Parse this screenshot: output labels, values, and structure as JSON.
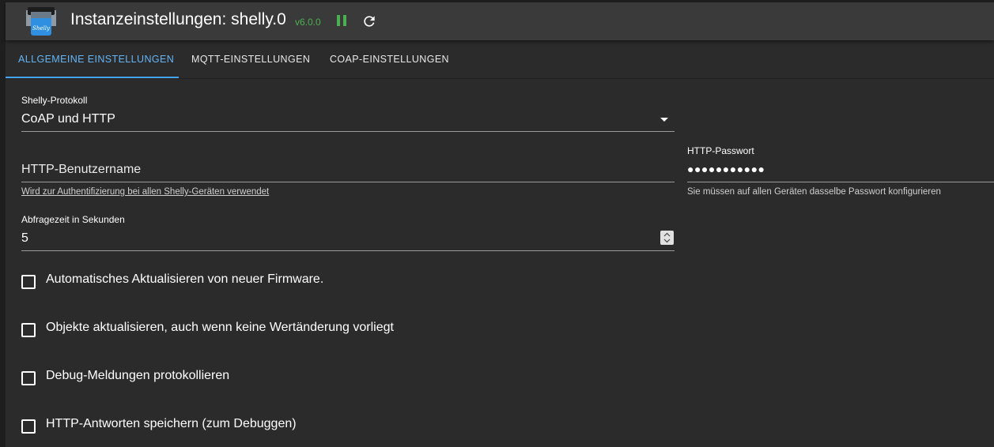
{
  "header": {
    "title": "Instanzeinstellungen: shelly.0",
    "version": "v6.0.0",
    "logo_text": "Shelly"
  },
  "tabs": [
    {
      "label": "ALLGEMEINE EINSTELLUNGEN",
      "active": true
    },
    {
      "label": "MQTT-EINSTELLUNGEN",
      "active": false
    },
    {
      "label": "COAP-EINSTELLUNGEN",
      "active": false
    }
  ],
  "form": {
    "protocol": {
      "label": "Shelly-Protokoll",
      "value": "CoAP und HTTP"
    },
    "username": {
      "placeholder": "HTTP-Benutzername",
      "helper": "Wird zur Authentifizierung bei allen Shelly-Geräten verwendet"
    },
    "password": {
      "label": "HTTP-Passwort",
      "value": "●●●●●●●●●●●",
      "helper": "Sie müssen auf allen Geräten dasselbe Passwort konfigurieren"
    },
    "polling": {
      "label": "Abfragezeit in Sekunden",
      "value": "5"
    }
  },
  "checkboxes": [
    {
      "label": "Automatisches Aktualisieren von neuer Firmware.",
      "checked": false
    },
    {
      "label": "Objekte aktualisieren, auch wenn keine Wertänderung vorliegt",
      "checked": false
    },
    {
      "label": "Debug-Meldungen protokollieren",
      "checked": false
    },
    {
      "label": "HTTP-Antworten speichern (zum Debuggen)",
      "checked": false
    }
  ],
  "colors": {
    "accent": "#42a5f5",
    "running": "#4caf50",
    "background": "#2b2b2b",
    "header": "#3a3a3a"
  },
  "icons": {
    "pause": "pause-icon",
    "reload": "reload-icon",
    "dropdown": "chevron-down-icon",
    "spinner": "spinner-arrows-icon"
  }
}
